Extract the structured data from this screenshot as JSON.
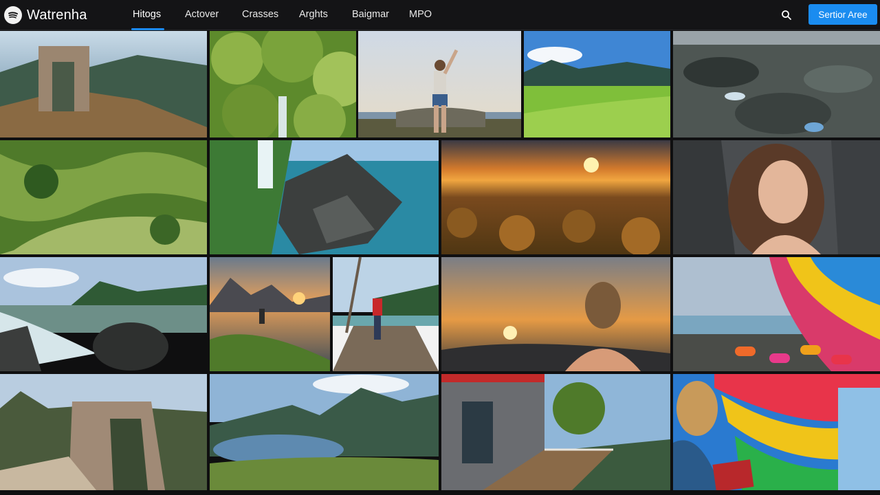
{
  "app": {
    "name": "Watrenha",
    "logo_icon": "app-logo-icon"
  },
  "nav": {
    "tabs": [
      {
        "label": "Hitogs",
        "active": true
      },
      {
        "label": "Actover",
        "active": false
      },
      {
        "label": "Crasses",
        "active": false
      },
      {
        "label": "Arghts",
        "active": false
      },
      {
        "label": "Baigmar",
        "active": false
      },
      {
        "label": "MPO",
        "active": false
      }
    ],
    "active_color": "#1d8cf8"
  },
  "search": {
    "icon": "search-icon"
  },
  "cta": {
    "label": "Sertior Aree",
    "color": "#1a8cf0"
  },
  "gallery": {
    "photos": [
      {
        "subject": "stone arch on mountain ridge"
      },
      {
        "subject": "forest waterfall"
      },
      {
        "subject": "person raising arm on rock"
      },
      {
        "subject": "green valley with hills"
      },
      {
        "subject": "volcanic rock coast"
      },
      {
        "subject": "aerial green hills"
      },
      {
        "subject": "waterfall on rocky coast"
      },
      {
        "subject": "sunset over forest plain"
      },
      {
        "subject": "woman portrait by rock"
      },
      {
        "subject": "river among green mountains"
      },
      {
        "subject": "person on rock at sunset lake"
      },
      {
        "subject": "person on boardwalk with bare tree"
      },
      {
        "subject": "woman silhouette at sunset"
      },
      {
        "subject": "colorful wall by bridge and stools"
      },
      {
        "subject": "rock arch and mountains"
      },
      {
        "subject": "mountain lake panorama"
      },
      {
        "subject": "red wooden house balcony"
      },
      {
        "subject": "woman reading by rainbow swirl wall"
      }
    ]
  }
}
